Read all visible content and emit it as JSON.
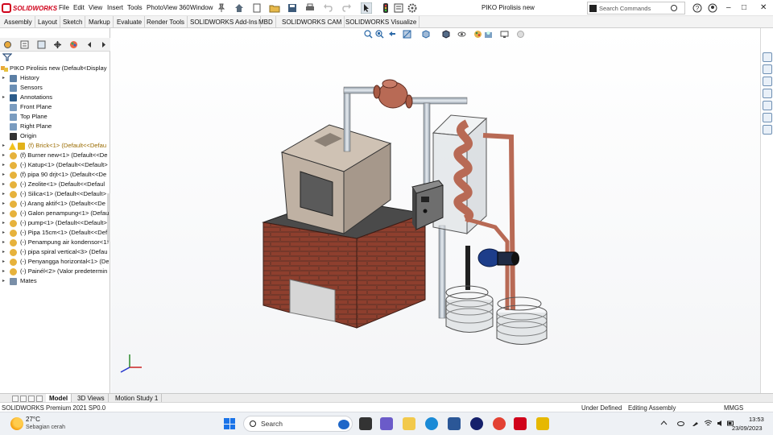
{
  "app": {
    "logo_text": "SOLIDWORKS",
    "menu": [
      "File",
      "Edit",
      "View",
      "Insert",
      "Tools",
      "PhotoView 360",
      "Window"
    ],
    "document_title": "PIKO Pirolisis new",
    "search_placeholder": "Search Commands",
    "window_controls": [
      "?",
      "–",
      "□",
      "✕"
    ]
  },
  "command_tabs": [
    "Assembly",
    "Layout",
    "Sketch",
    "Markup",
    "Evaluate",
    "Render Tools",
    "SOLIDWORKS Add-Ins",
    "MBD",
    "SOLIDWORKS CAM",
    "SOLIDWORKS Visualize"
  ],
  "feature_tree": {
    "root": "PIKO Pirolisis new  (Default<Display",
    "items": [
      {
        "label": "History",
        "icon": "history-icon",
        "arrow": true
      },
      {
        "label": "Sensors",
        "icon": "sensor-icon",
        "arrow": false
      },
      {
        "label": "Annotations",
        "icon": "annotation-icon",
        "arrow": true
      },
      {
        "label": "Front Plane",
        "icon": "plane-icon",
        "arrow": false
      },
      {
        "label": "Top Plane",
        "icon": "plane-icon",
        "arrow": false
      },
      {
        "label": "Right Plane",
        "icon": "plane-icon",
        "arrow": false
      },
      {
        "label": "Origin",
        "icon": "origin-icon",
        "arrow": false
      },
      {
        "label": "(f) Brick<1> (Default<<Defau",
        "icon": "warning-icon",
        "arrow": true,
        "warn": true
      },
      {
        "label": "(f) Burner new<1> (Default<<De",
        "icon": "part-icon",
        "arrow": true
      },
      {
        "label": "(-) Katup<1> (Default<<Default>",
        "icon": "part-icon",
        "arrow": true
      },
      {
        "label": "(f) pipa 90 drjt<1> (Default<<De",
        "icon": "part-icon",
        "arrow": true
      },
      {
        "label": "(-) Zeolite<1> (Default<<Defaul",
        "icon": "part-icon",
        "arrow": true
      },
      {
        "label": "(-) Silica<1> (Default<<Default>",
        "icon": "part-icon",
        "arrow": true
      },
      {
        "label": "(-) Arang aktif<1> (Default<<De",
        "icon": "part-icon",
        "arrow": true
      },
      {
        "label": "(-) Galon penampung<1> (Defau",
        "icon": "part-icon",
        "arrow": true
      },
      {
        "label": "(-) pump<1> (Default<<Default>",
        "icon": "part-icon",
        "arrow": true
      },
      {
        "label": "(-) Pipa 15cm<1> (Default<<Def",
        "icon": "part-icon",
        "arrow": true
      },
      {
        "label": "(-) Penampung air kondensor<1>",
        "icon": "part-icon",
        "arrow": true
      },
      {
        "label": "(-) pipa spiral vertical<3> (Defau",
        "icon": "part-icon",
        "arrow": true
      },
      {
        "label": "(-) Penyangga horizontal<1> (De",
        "icon": "part-icon",
        "arrow": true
      },
      {
        "label": "(-) Painél<2> (Valor predetermin",
        "icon": "part-icon",
        "arrow": true
      },
      {
        "label": "Mates",
        "icon": "mates-icon",
        "arrow": true
      }
    ]
  },
  "bottom_tabs": [
    "Model",
    "3D Views",
    "Motion Study 1"
  ],
  "status": {
    "product": "SOLIDWORKS Premium 2021 SP0.0",
    "state": "Under Defined",
    "mode": "Editing Assembly",
    "units": "MMGS"
  },
  "taskbar": {
    "weather_temp": "27°C",
    "weather_desc": "Sebagian cerah",
    "search_placeholder": "Search",
    "time": "13:53",
    "date": "23/09/2023"
  },
  "colors": {
    "brand_red": "#d0021b",
    "brick": "#8c3d2e",
    "copper": "#b86a55",
    "accent_blue": "#1a73e8"
  }
}
